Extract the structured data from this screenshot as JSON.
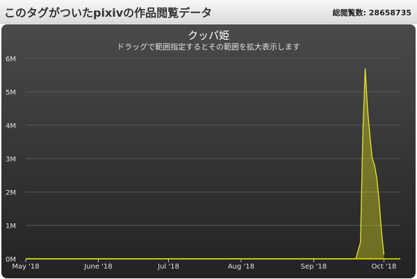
{
  "header": {
    "title": "このタグがついたpixivの作品閲覧データ",
    "total_label": "総閲覧数:",
    "total_value": "28658735"
  },
  "colors": {
    "series_line": "#e8e832",
    "series_fill": "#c8c820",
    "grid": "#5a5a5a",
    "text": "#e0e0e0"
  },
  "chart_data": {
    "type": "area",
    "title": "クッパ姫",
    "subtitle": "ドラッグで範囲指定するとその範囲を拡大表示します",
    "xlabel": "",
    "ylabel": "",
    "x_range": [
      "2018-05-01",
      "2018-10-08"
    ],
    "ylim": [
      0,
      6000000
    ],
    "y_ticks": [
      {
        "value": 0,
        "label": "0M"
      },
      {
        "value": 1000000,
        "label": "1M"
      },
      {
        "value": 2000000,
        "label": "2M"
      },
      {
        "value": 3000000,
        "label": "3M"
      },
      {
        "value": 4000000,
        "label": "4M"
      },
      {
        "value": 5000000,
        "label": "5M"
      },
      {
        "value": 6000000,
        "label": "6M"
      }
    ],
    "x_ticks": [
      {
        "date": "2018-05-01",
        "label": "May '18"
      },
      {
        "date": "2018-06-01",
        "label": "June '18"
      },
      {
        "date": "2018-07-01",
        "label": "Jul '18"
      },
      {
        "date": "2018-08-01",
        "label": "Aug '18"
      },
      {
        "date": "2018-09-01",
        "label": "Sep '18"
      },
      {
        "date": "2018-10-01",
        "label": "Oct '18"
      }
    ],
    "grid": true,
    "legend": "none",
    "series": [
      {
        "points": [
          {
            "x": "2018-05-01",
            "y": 0
          },
          {
            "x": "2018-09-15",
            "y": 0
          },
          {
            "x": "2018-09-19",
            "y": 0
          },
          {
            "x": "2018-09-21",
            "y": 500000
          },
          {
            "x": "2018-09-22",
            "y": 3800000
          },
          {
            "x": "2018-09-23",
            "y": 5700000
          },
          {
            "x": "2018-09-24",
            "y": 4500000
          },
          {
            "x": "2018-09-25",
            "y": 3700000
          },
          {
            "x": "2018-09-26",
            "y": 3000000
          },
          {
            "x": "2018-09-27",
            "y": 2800000
          },
          {
            "x": "2018-09-28",
            "y": 2400000
          },
          {
            "x": "2018-09-29",
            "y": 1700000
          },
          {
            "x": "2018-09-30",
            "y": 800000
          },
          {
            "x": "2018-10-01",
            "y": 120000
          }
        ]
      }
    ]
  }
}
